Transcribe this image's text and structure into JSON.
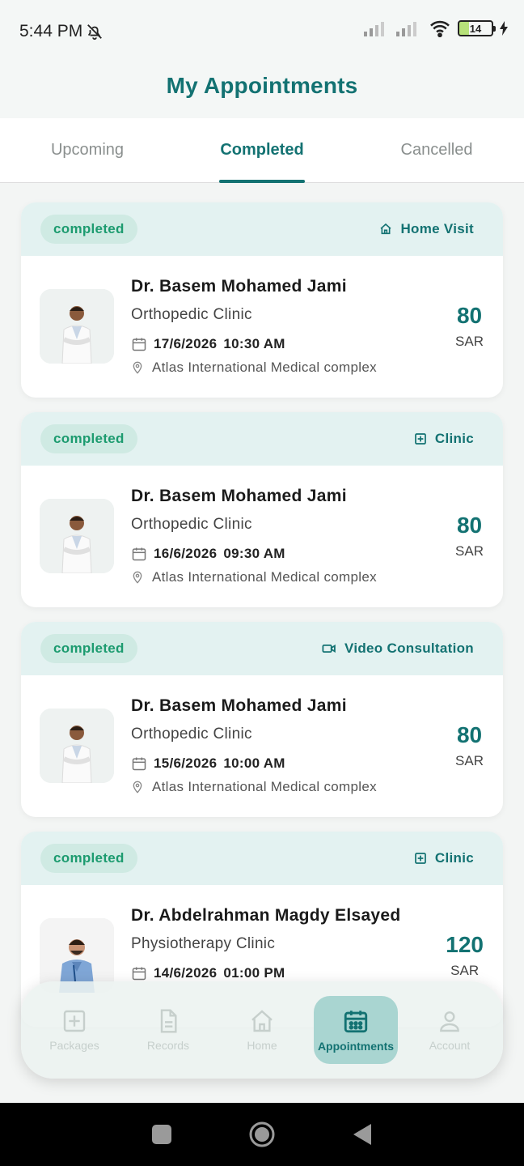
{
  "status_bar": {
    "time": "5:44 PM",
    "battery": "14"
  },
  "header": {
    "title": "My Appointments"
  },
  "tabs": [
    {
      "label": "Upcoming",
      "active": false
    },
    {
      "label": "Completed",
      "active": true
    },
    {
      "label": "Cancelled",
      "active": false
    }
  ],
  "appointments": [
    {
      "status": "completed",
      "visit_type": "Home Visit",
      "visit_icon": "home-icon",
      "doctor": "Dr. Basem Mohamed Jami",
      "clinic": "Orthopedic Clinic",
      "date": "17/6/2026",
      "time": "10:30 AM",
      "location": "Atlas International Medical complex",
      "price": "80",
      "currency": "SAR"
    },
    {
      "status": "completed",
      "visit_type": "Clinic",
      "visit_icon": "plus-square-icon",
      "doctor": "Dr. Basem Mohamed Jami",
      "clinic": "Orthopedic Clinic",
      "date": "16/6/2026",
      "time": "09:30 AM",
      "location": "Atlas International Medical complex",
      "price": "80",
      "currency": "SAR"
    },
    {
      "status": "completed",
      "visit_type": "Video Consultation",
      "visit_icon": "video-icon",
      "doctor": "Dr. Basem Mohamed Jami",
      "clinic": "Orthopedic Clinic",
      "date": "15/6/2026",
      "time": "10:00 AM",
      "location": "Atlas International Medical complex",
      "price": "80",
      "currency": "SAR"
    },
    {
      "status": "completed",
      "visit_type": "Clinic",
      "visit_icon": "plus-square-icon",
      "doctor": "Dr. Abdelrahman Magdy Elsayed",
      "clinic": "Physiotherapy Clinic",
      "date": "14/6/2026",
      "time": "01:00 PM",
      "location": "",
      "price": "120",
      "currency": "SAR"
    }
  ],
  "bottom_nav": [
    {
      "label": "Packages",
      "icon": "plus-square-icon",
      "active": false
    },
    {
      "label": "Records",
      "icon": "document-icon",
      "active": false
    },
    {
      "label": "Home",
      "icon": "home-icon",
      "active": false
    },
    {
      "label": "Appointments",
      "icon": "calendar-icon",
      "active": true
    },
    {
      "label": "Account",
      "icon": "user-icon",
      "active": false
    }
  ],
  "colors": {
    "primary": "#137272",
    "badge_text": "#1c9b6f",
    "badge_bg": "#cfeae3",
    "card_header_bg": "#e3f2f1"
  }
}
